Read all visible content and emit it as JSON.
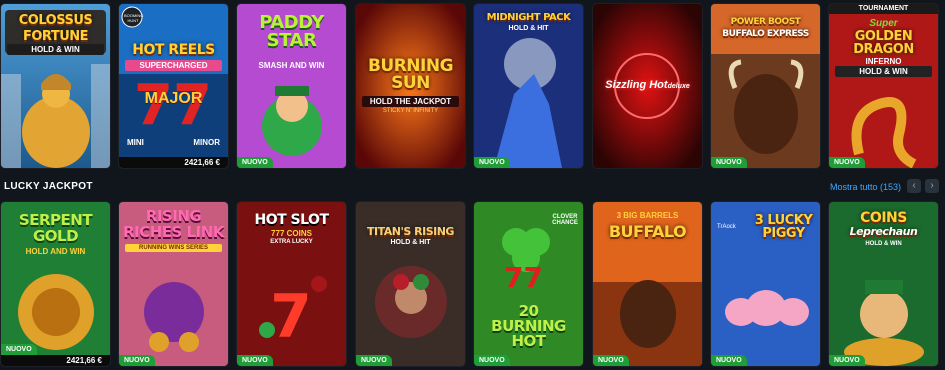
{
  "top_row": [
    {
      "name": "Colossus Fortune",
      "line1": "COLOSSUS",
      "line2": "FORTUNE",
      "sub": "HOLD & WIN",
      "nuovo": false,
      "jackpot": ""
    },
    {
      "name": "Hot Reels Supercharged",
      "line1": "HOT REELS",
      "line2": "",
      "sub": "SUPERCHARGED",
      "extra": [
        "MAJOR",
        "MINI",
        "MINOR"
      ],
      "corner": "BOOMING HUNT",
      "nuovo": false,
      "jackpot": "2421,66 €"
    },
    {
      "name": "Paddy Star",
      "line1": "PADDY",
      "line2": "STAR",
      "sub": "SMASH AND WIN",
      "nuovo": true,
      "jackpot": ""
    },
    {
      "name": "Burning Sun",
      "line1": "BURNING",
      "line2": "SUN",
      "sub": "HOLD THE JACKPOT",
      "extra2": "STICKY N' INFINITY",
      "nuovo": false,
      "jackpot": ""
    },
    {
      "name": "Midnight Pack",
      "line1": "MIDNIGHT PACK",
      "line2": "",
      "sub": "HOLD & HIT",
      "nuovo": true,
      "jackpot": ""
    },
    {
      "name": "Sizzling Hot deluxe",
      "line1": "Sizzling Hot",
      "line2": "deluxe",
      "sub": "",
      "nuovo": false,
      "jackpot": ""
    },
    {
      "name": "Power Boost Buffalo Express",
      "line1": "POWER BOOST",
      "line2": "BUFFALO EXPRESS",
      "sub": "",
      "nuovo": true,
      "jackpot": ""
    },
    {
      "name": "Super Golden Dragon Inferno",
      "top": "TOURNAMENT",
      "line1": "Super",
      "line2": "GOLDEN DRAGON",
      "sub": "INFERNO",
      "extra": "HOLD & WIN",
      "nuovo": true,
      "jackpot": ""
    }
  ],
  "section": {
    "title": "LUCKY JACKPOT",
    "show_all": "Mostra tutto (153)",
    "prev_icon": "‹",
    "next_icon": "›"
  },
  "bottom_row": [
    {
      "name": "Serpent Gold",
      "line1": "SERPENT",
      "line2": "GOLD",
      "sub": "HOLD AND WIN",
      "nuovo": true,
      "jackpot": "2421,66 €"
    },
    {
      "name": "Rising Riches Link",
      "line1": "RISING",
      "line2": "RICHES LINK",
      "sub": "RUNNING WINS SERIES",
      "nuovo": true,
      "jackpot": ""
    },
    {
      "name": "Hot Slot 777 Coins",
      "line1": "HOT SLOT",
      "line2": "",
      "sub": "777 COINS",
      "extra": "EXTRA LUCKY",
      "nuovo": true,
      "jackpot": ""
    },
    {
      "name": "Titan's Rising",
      "line1": "TITAN'S RISING",
      "line2": "",
      "sub": "HOLD & HIT",
      "nuovo": true,
      "jackpot": ""
    },
    {
      "name": "20 Burning Hot Clover Chance",
      "line1": "20",
      "line2": "BURNING",
      "line3": "HOT",
      "corner": "CLOVER CHANCE",
      "nuovo": true,
      "jackpot": ""
    },
    {
      "name": "3 Big Barrels Buffalo",
      "line1": "3 BIG BARRELS",
      "line2": "BUFFALO",
      "sub": "",
      "nuovo": true,
      "jackpot": ""
    },
    {
      "name": "3 Lucky Piggy",
      "line1": "3",
      "line2": "LUCKY",
      "line3": "PIGGY",
      "corner": "TrAock",
      "nuovo": true,
      "jackpot": ""
    },
    {
      "name": "Coins of Leprechaun",
      "line1": "COINS",
      "line2": "Leprechaun",
      "sub": "HOLD & WIN",
      "nuovo": true,
      "jackpot": ""
    }
  ],
  "badge_label": "NUOVO",
  "colors": {
    "bg": "#11161c",
    "nuovo": "#1f9d36",
    "link": "#3fa9ff"
  }
}
